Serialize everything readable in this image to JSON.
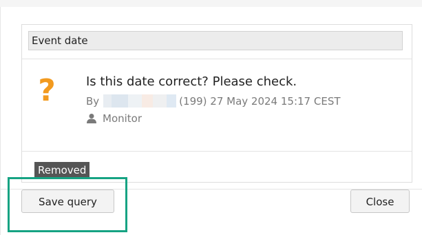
{
  "field": {
    "label": "Event date"
  },
  "query": {
    "icon": "question-mark-icon",
    "question": "Is this date correct? Please check.",
    "by_prefix": "By",
    "user_id": "(199)",
    "timestamp": "27 May 2024 15:17 CEST",
    "role": "Monitor",
    "status": "Removed"
  },
  "footer": {
    "save_label": "Save query",
    "close_label": "Close"
  },
  "colors": {
    "question_icon": "#f29a1f",
    "status_badge": "#555555",
    "highlight": "#16a383"
  }
}
